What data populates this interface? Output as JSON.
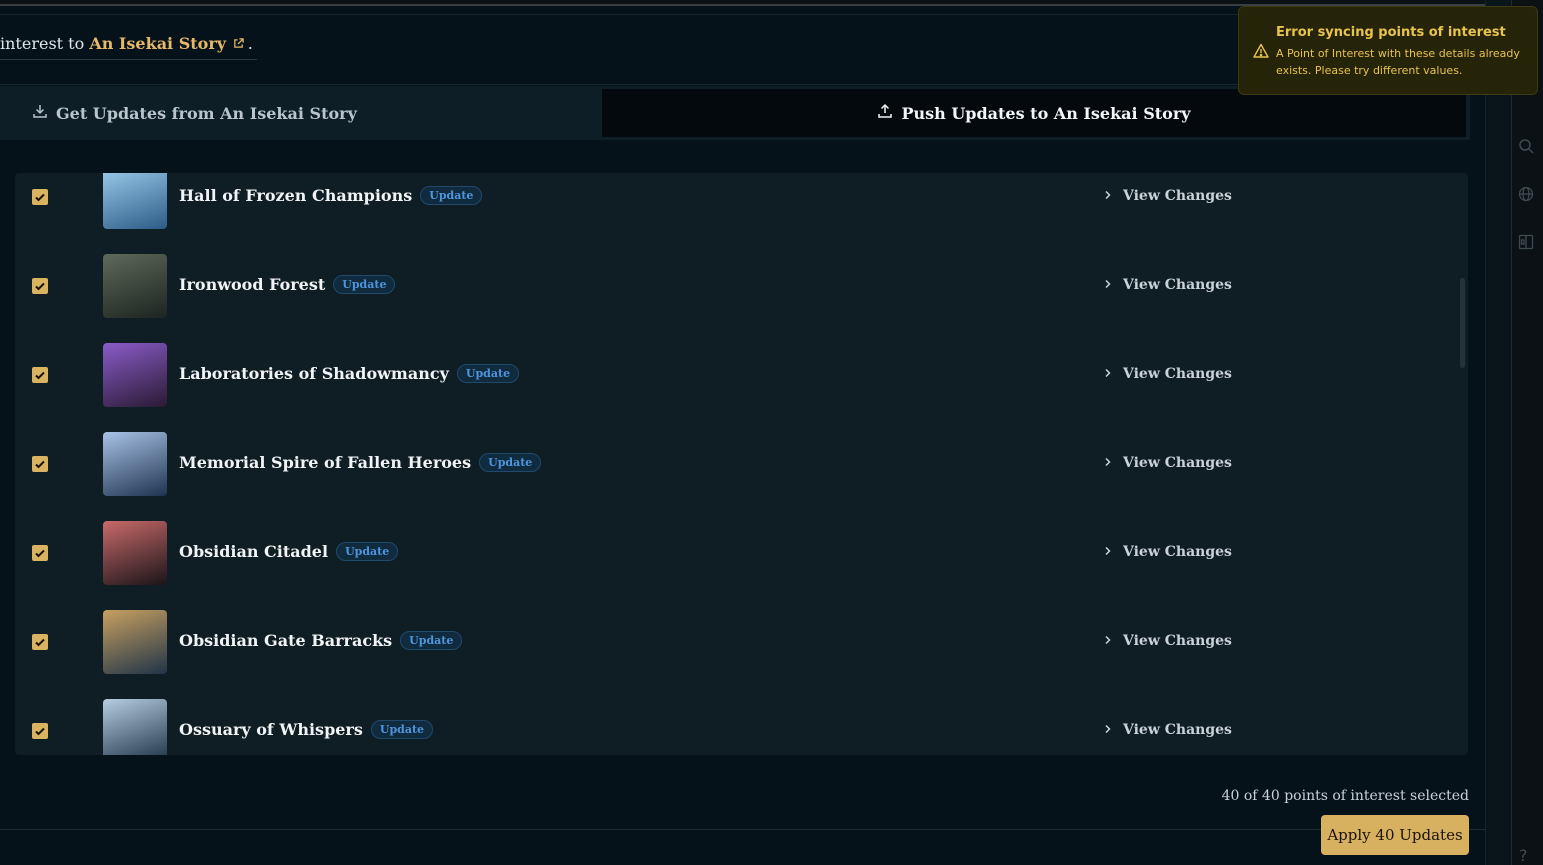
{
  "intro": {
    "prefix": "interest to ",
    "link": "An Isekai Story",
    "suffix": "."
  },
  "tabs": {
    "get": "Get Updates from An Isekai Story",
    "push": "Push Updates to An Isekai Story"
  },
  "toast": {
    "title": "Error syncing points of interest",
    "message": "A Point of Interest with these details already exists. Please try different values."
  },
  "items": [
    {
      "name": "Hall of Frozen Champions",
      "badge": "Update",
      "action": "View Changes",
      "checked": true,
      "thumb_colors": [
        "#9fd0ef",
        "#2c5b86"
      ]
    },
    {
      "name": "Ironwood Forest",
      "badge": "Update",
      "action": "View Changes",
      "checked": true,
      "thumb_colors": [
        "#5e6a5a",
        "#1c2420"
      ]
    },
    {
      "name": "Laboratories of Shadowmancy",
      "badge": "Update",
      "action": "View Changes",
      "checked": true,
      "thumb_colors": [
        "#8a5cc9",
        "#2a1a33"
      ]
    },
    {
      "name": "Memorial Spire of Fallen Heroes",
      "badge": "Update",
      "action": "View Changes",
      "checked": true,
      "thumb_colors": [
        "#a8c3e6",
        "#1f3350"
      ]
    },
    {
      "name": "Obsidian Citadel",
      "badge": "Update",
      "action": "View Changes",
      "checked": true,
      "thumb_colors": [
        "#c96a6a",
        "#1a1418"
      ]
    },
    {
      "name": "Obsidian Gate Barracks",
      "badge": "Update",
      "action": "View Changes",
      "checked": true,
      "thumb_colors": [
        "#c8a060",
        "#203448"
      ]
    },
    {
      "name": "Ossuary of Whispers",
      "badge": "Update",
      "action": "View Changes",
      "checked": true,
      "thumb_colors": [
        "#b7cde0",
        "#1c3045"
      ]
    }
  ],
  "footer": {
    "selected_text": "40 of 40 points of interest selected",
    "apply_label": "Apply 40 Updates"
  },
  "colors": {
    "accent": "#d7b060",
    "badge": "#4f95dd",
    "panel": "#0f1d24",
    "warning": "#e8c34e"
  }
}
